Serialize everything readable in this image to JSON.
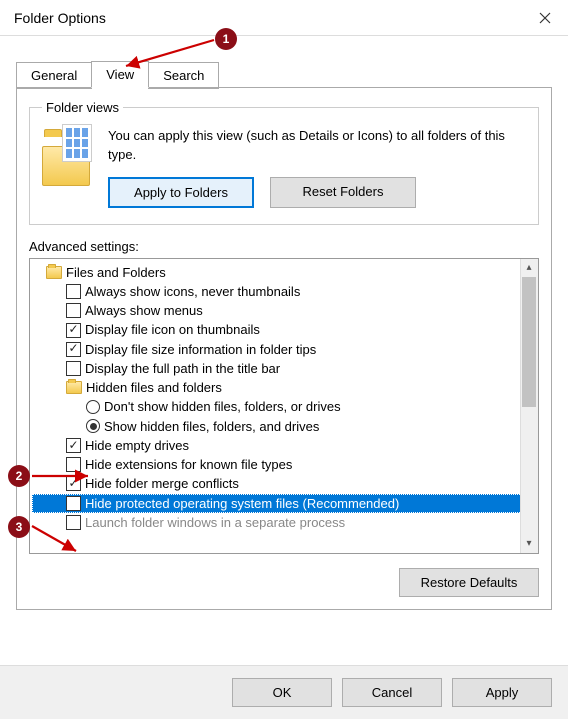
{
  "title": "Folder Options",
  "tabs": {
    "general": "General",
    "view": "View",
    "search": "Search"
  },
  "folderViews": {
    "legend": "Folder views",
    "text": "You can apply this view (such as Details or Icons) to all folders of this type.",
    "apply": "Apply to Folders",
    "reset": "Reset Folders"
  },
  "advancedLabel": "Advanced settings:",
  "settings": {
    "filesFolders": "Files and Folders",
    "alwaysIcons": "Always show icons, never thumbnails",
    "alwaysMenus": "Always show menus",
    "fileIconThumb": "Display file icon on thumbnails",
    "fileSizeTips": "Display file size information in folder tips",
    "fullPathTitle": "Display the full path in the title bar",
    "hiddenGroup": "Hidden files and folders",
    "dontShowHidden": "Don't show hidden files, folders, or drives",
    "showHidden": "Show hidden files, folders, and drives",
    "hideEmptyDrives": "Hide empty drives",
    "hideExt": "Hide extensions for known file types",
    "hideMerge": "Hide folder merge conflicts",
    "hideProtected": "Hide protected operating system files (Recommended)",
    "launchSeparate": "Launch folder windows in a separate process"
  },
  "restoreDefaults": "Restore Defaults",
  "buttons": {
    "ok": "OK",
    "cancel": "Cancel",
    "apply": "Apply"
  },
  "callouts": {
    "c1": "1",
    "c2": "2",
    "c3": "3"
  }
}
